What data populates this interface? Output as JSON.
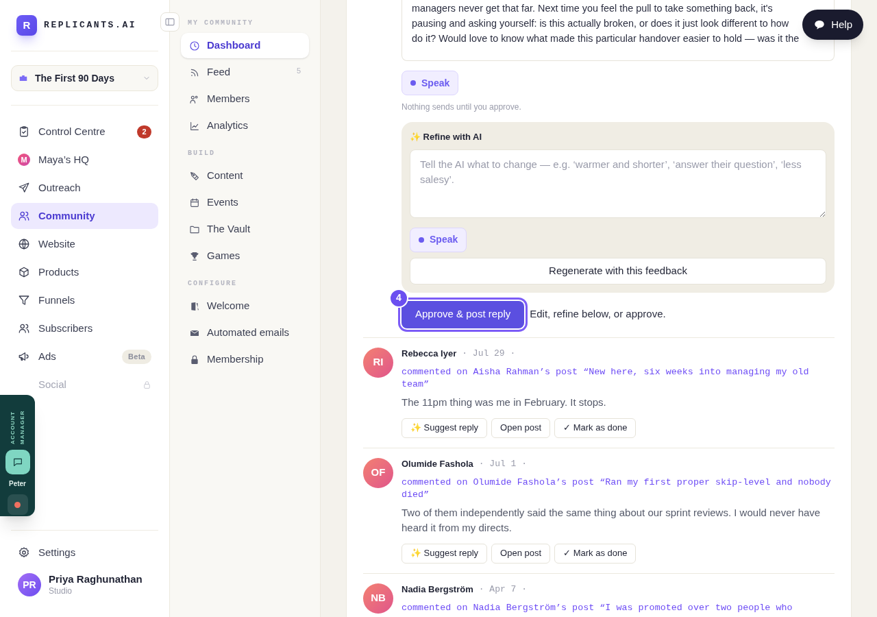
{
  "brand": {
    "logo_letter": "R",
    "name": "REPLICANTS.AI"
  },
  "workspace": {
    "label": "The First 90 Days"
  },
  "main_nav": [
    {
      "label": "Control Centre",
      "selected": false,
      "disabled": false,
      "badge": "2"
    },
    {
      "label": "Maya’s HQ",
      "kind": "avatar",
      "avatar_letter": "M",
      "selected": false,
      "disabled": false
    },
    {
      "label": "Outreach",
      "selected": false,
      "disabled": false
    },
    {
      "label": "Community",
      "selected": true,
      "disabled": false
    },
    {
      "label": "Website",
      "selected": false,
      "disabled": false
    },
    {
      "label": "Products",
      "selected": false,
      "disabled": false
    },
    {
      "label": "Funnels",
      "selected": false,
      "disabled": false
    },
    {
      "label": "Subscribers",
      "selected": false,
      "disabled": false
    },
    {
      "label": "Ads",
      "selected": false,
      "disabled": false,
      "tag": "Beta"
    },
    {
      "label": "Social",
      "selected": false,
      "disabled": true,
      "locked": true
    }
  ],
  "account_manager": {
    "title": "ACCOUNT MANAGER",
    "name": "Peter"
  },
  "footer": {
    "settings": "Settings",
    "user": {
      "initials": "PR",
      "name": "Priya Raghunathan",
      "plan": "Studio"
    }
  },
  "community_nav": [
    {
      "title": "MY COMMUNITY",
      "items": [
        {
          "label": "Dashboard",
          "selected": true
        },
        {
          "label": "Feed",
          "selected": false,
          "count": "5"
        },
        {
          "label": "Members",
          "selected": false
        },
        {
          "label": "Analytics",
          "selected": false
        }
      ]
    },
    {
      "title": "BUILD",
      "items": [
        {
          "label": "Content",
          "selected": false
        },
        {
          "label": "Events",
          "selected": false
        },
        {
          "label": "The Vault",
          "selected": false
        },
        {
          "label": "Games",
          "selected": false
        }
      ]
    },
    {
      "title": "CONFIGURE",
      "items": [
        {
          "label": "Welcome",
          "selected": false
        },
        {
          "label": "Automated emails",
          "selected": false
        },
        {
          "label": "Membership",
          "selected": false
        }
      ]
    }
  ],
  "reply": {
    "lines": [
      "managers never get that far. Next time you feel the pull to take something back, it's",
      "pausing and asking yourself: is this actually broken, or does it just look different to how",
      "do it? Would love to know what made this particular handover easier to hold — was it the"
    ],
    "speak": "Speak",
    "note": "Nothing sends until you approve.",
    "refine": {
      "title": "✨ Refine with AI",
      "placeholder": "Tell the AI what to change — e.g. ‘warmer and shorter’, ‘answer their question’, ‘less salesy’.",
      "speak": "Speak",
      "button": "Regenerate with this feedback"
    },
    "step": "4",
    "approve": "Approve & post reply",
    "hint": "Edit, refine below, or approve."
  },
  "comments": [
    {
      "initials": "RI",
      "name": "Rebecca Iyer",
      "date": "· Jul 29 ·",
      "context": "commented on Aisha Rahman’s post “New here, six weeks into managing my old team”",
      "text": "The 11pm thing was me in February. It stops.",
      "actions": [
        "✨ Suggest reply",
        "Open post",
        "✓ Mark as done"
      ]
    },
    {
      "initials": "OF",
      "name": "Olumide Fashola",
      "date": "· Jul 1 ·",
      "context": "commented on Olumide Fashola’s post “Ran my first proper skip-level and nobody died”",
      "text": "Two of them independently said the same thing about our sprint reviews. I would never have heard it from my directs.",
      "actions": [
        "✨ Suggest reply",
        "Open post",
        "✓ Mark as done"
      ]
    },
    {
      "initials": "NB",
      "name": "Nadia Bergström",
      "date": "· Apr 7 ·",
      "context": "commented on Nadia Bergström’s post “I was promoted over two people who"
    }
  ],
  "help": "Help"
}
